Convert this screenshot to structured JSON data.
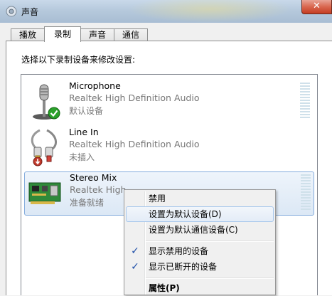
{
  "window": {
    "title": "声音",
    "close": "✕"
  },
  "tabs": [
    {
      "label": "播放"
    },
    {
      "label": "录制"
    },
    {
      "label": "声音"
    },
    {
      "label": "通信"
    }
  ],
  "instruction": "选择以下录制设备来修改设置:",
  "devices": [
    {
      "name": "Microphone",
      "driver": "Realtek High Definition Audio",
      "status": "默认设备",
      "icon": "microphone-icon",
      "badge": "default-check-badge"
    },
    {
      "name": "Line In",
      "driver": "Realtek High Definition Audio",
      "status": "未插入",
      "icon": "line-in-cable-icon",
      "badge": "unplugged-badge"
    },
    {
      "name": "Stereo Mix",
      "driver": "Realtek High",
      "status": "准备就绪",
      "icon": "sound-card-icon"
    }
  ],
  "context_menu": {
    "items": [
      {
        "label": "禁用"
      },
      {
        "label": "设置为默认设备(D)"
      },
      {
        "label": "设置为默认通信设备(C)"
      },
      {
        "label": "显示禁用的设备",
        "checked": true
      },
      {
        "label": "显示已断开的设备",
        "checked": true
      },
      {
        "label": "属性(P)"
      }
    ],
    "check_glyph": "✓"
  },
  "colors": {
    "accent": "#1f4fa8",
    "selection_border": "#84acdd",
    "default_badge": "#2aa12a",
    "unplugged_badge": "#c0392b"
  }
}
